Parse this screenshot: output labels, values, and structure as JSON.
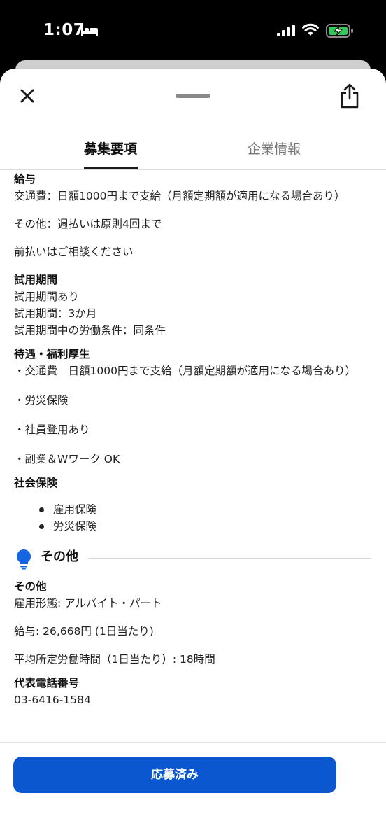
{
  "status_bar": {
    "time": "1:07"
  },
  "tabs": [
    {
      "label": "募集要項",
      "active": true
    },
    {
      "label": "企業情報",
      "active": false
    }
  ],
  "details": {
    "salary": {
      "heading": "給与",
      "lines": [
        "交通費：日額1000円まで支給（月額定期額が適用になる場合あり）",
        "その他：週払いは原則4回まで",
        "前払いはご相談ください"
      ]
    },
    "trial": {
      "heading": "試用期間",
      "lines": [
        "試用期間あり",
        "試用期間：3か月",
        "試用期間中の労働条件：同条件"
      ]
    },
    "benefits": {
      "heading": "待遇・福利厚生",
      "lines": [
        "・交通費　日額1000円まで支給（月額定期額が適用になる場合あり）",
        "・労災保険",
        "・社員登用あり",
        "・副業＆Wワーク OK"
      ]
    },
    "insurance": {
      "heading": "社会保険",
      "items": [
        "雇用保険",
        "労災保険"
      ]
    }
  },
  "other_section": {
    "title": "その他",
    "icon": "lightbulb-icon",
    "subheading": "その他",
    "lines": [
      "雇用形態: アルバイト・パート",
      "給与: 26,668円 (1日当たり)",
      "平均所定労働時間（1日当たり）: 18時間"
    ],
    "phone_heading": "代表電話番号",
    "phone": "03-6416-1584"
  },
  "apply_button": {
    "label": "応募済み"
  },
  "colors": {
    "accent": "#0b57d0",
    "bulb": "#1565e0"
  }
}
